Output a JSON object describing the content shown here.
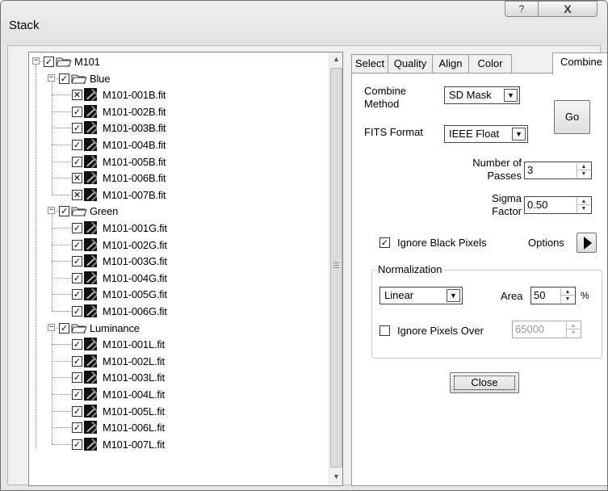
{
  "window": {
    "title": "Stack",
    "help_glyph": "?",
    "close_glyph": "X"
  },
  "tree": {
    "expander_glyph": "−",
    "scroll_up_glyph": "▲",
    "scroll_down_glyph": "▼",
    "root": {
      "label": "M101",
      "checked": true
    },
    "groups": [
      {
        "label": "Blue",
        "checked": true,
        "files": [
          {
            "label": "M101-001B.fit",
            "state": "excluded"
          },
          {
            "label": "M101-002B.fit",
            "state": "checked"
          },
          {
            "label": "M101-003B.fit",
            "state": "checked",
            "selected": true
          },
          {
            "label": "M101-004B.fit",
            "state": "checked"
          },
          {
            "label": "M101-005B.fit",
            "state": "checked"
          },
          {
            "label": "M101-006B.fit",
            "state": "excluded"
          },
          {
            "label": "M101-007B.fit",
            "state": "excluded"
          }
        ]
      },
      {
        "label": "Green",
        "checked": true,
        "files": [
          {
            "label": "M101-001G.fit",
            "state": "checked"
          },
          {
            "label": "M101-002G.fit",
            "state": "checked"
          },
          {
            "label": "M101-003G.fit",
            "state": "checked"
          },
          {
            "label": "M101-004G.fit",
            "state": "checked"
          },
          {
            "label": "M101-005G.fit",
            "state": "checked"
          },
          {
            "label": "M101-006G.fit",
            "state": "checked"
          }
        ]
      },
      {
        "label": "Luminance",
        "checked": true,
        "files": [
          {
            "label": "M101-001L.fit",
            "state": "checked"
          },
          {
            "label": "M101-002L.fit",
            "state": "checked"
          },
          {
            "label": "M101-003L.fit",
            "state": "checked"
          },
          {
            "label": "M101-004L.fit",
            "state": "checked"
          },
          {
            "label": "M101-005L.fit",
            "state": "checked"
          },
          {
            "label": "M101-006L.fit",
            "state": "checked"
          },
          {
            "label": "M101-007L.fit",
            "state": "checked"
          }
        ]
      }
    ]
  },
  "tabs": [
    {
      "label": "Select",
      "active": false
    },
    {
      "label": "Quality",
      "active": false
    },
    {
      "label": "Align",
      "active": false
    },
    {
      "label": "Color",
      "active": false
    },
    {
      "label": "Combine",
      "active": true
    }
  ],
  "combine": {
    "method_label_1": "Combine",
    "method_label_2": "Method",
    "method_value": "SD Mask",
    "go_label": "Go",
    "fits_label": "FITS Format",
    "fits_value": "IEEE Float",
    "passes_label_1": "Number of",
    "passes_label_2": "Passes",
    "passes_value": "3",
    "sigma_label_1": "Sigma",
    "sigma_label_2": "Factor",
    "sigma_value": "0.50",
    "ignore_black_label": "Ignore Black Pixels",
    "ignore_black_checked": true,
    "options_label": "Options",
    "normalization": {
      "title": "Normalization",
      "mode_value": "Linear",
      "area_label": "Area",
      "area_value": "50",
      "area_unit": "%",
      "ignore_over_label": "Ignore Pixels Over",
      "ignore_over_checked": false,
      "ignore_over_value": "65000"
    },
    "close_label": "Close"
  },
  "glyphs": {
    "check": "✓",
    "cross": "✕",
    "combo_arrow": "▼",
    "spin_up": "▲",
    "spin_down": "▼"
  }
}
